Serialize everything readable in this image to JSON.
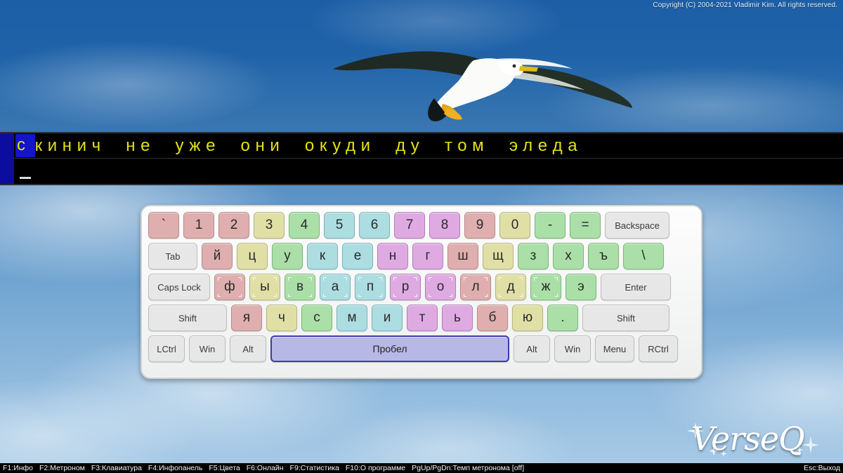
{
  "app": {
    "name": "VerseQ",
    "copyright": "Copyright (C) 2004-2021 Vladimir Kim. All rights reserved.",
    "logo_text": "VerseQ"
  },
  "wallpaper": {
    "description": "seagull-flying-blue-sky",
    "sky_color": "#3d79b5",
    "band_color": "#1f62a8"
  },
  "typing": {
    "cursor_char": "с",
    "line1_rest": "кинич  не  уже  они  окуди  ду  том  элeда",
    "line1_full": "скинич не уже они окуди ду том элeда",
    "line2": "",
    "text_color": "#e3e312",
    "background_color": "#000000",
    "cursor_color": "#1414c8",
    "margin_color": "#0c0c9e"
  },
  "keyboard": {
    "rows": [
      [
        {
          "label": "`",
          "color": "red",
          "type": "char",
          "w": "w-key"
        },
        {
          "label": "1",
          "color": "red",
          "type": "char",
          "w": "w-key"
        },
        {
          "label": "2",
          "color": "red",
          "type": "char",
          "w": "w-key"
        },
        {
          "label": "3",
          "color": "yellow",
          "type": "char",
          "w": "w-key"
        },
        {
          "label": "4",
          "color": "green",
          "type": "char",
          "w": "w-key"
        },
        {
          "label": "5",
          "color": "cyan",
          "type": "char",
          "w": "w-key"
        },
        {
          "label": "6",
          "color": "cyan",
          "type": "char",
          "w": "w-key"
        },
        {
          "label": "7",
          "color": "purple",
          "type": "char",
          "w": "w-key"
        },
        {
          "label": "8",
          "color": "purple",
          "type": "char",
          "w": "w-key"
        },
        {
          "label": "9",
          "color": "red",
          "type": "char",
          "w": "w-key"
        },
        {
          "label": "0",
          "color": "yellow",
          "type": "char",
          "w": "w-key"
        },
        {
          "label": "-",
          "color": "green",
          "type": "char",
          "w": "w-key"
        },
        {
          "label": "=",
          "color": "green",
          "type": "char",
          "w": "w-key"
        },
        {
          "label": "Backspace",
          "color": "mod",
          "type": "mod",
          "w": "w-bksp"
        }
      ],
      [
        {
          "label": "Tab",
          "color": "mod",
          "type": "mod",
          "w": "w-tab"
        },
        {
          "label": "й",
          "color": "red",
          "type": "char",
          "w": "w-key"
        },
        {
          "label": "ц",
          "color": "yellow",
          "type": "char",
          "w": "w-key"
        },
        {
          "label": "у",
          "color": "green",
          "type": "char",
          "w": "w-key"
        },
        {
          "label": "к",
          "color": "cyan",
          "type": "char",
          "w": "w-key"
        },
        {
          "label": "е",
          "color": "cyan",
          "type": "char",
          "w": "w-key"
        },
        {
          "label": "н",
          "color": "purple",
          "type": "char",
          "w": "w-key"
        },
        {
          "label": "г",
          "color": "purple",
          "type": "char",
          "w": "w-key"
        },
        {
          "label": "ш",
          "color": "red",
          "type": "char",
          "w": "w-key"
        },
        {
          "label": "щ",
          "color": "yellow",
          "type": "char",
          "w": "w-key"
        },
        {
          "label": "з",
          "color": "green",
          "type": "char",
          "w": "w-key"
        },
        {
          "label": "х",
          "color": "green",
          "type": "char",
          "w": "w-key"
        },
        {
          "label": "ъ",
          "color": "green",
          "type": "char",
          "w": "w-key"
        },
        {
          "label": "\\",
          "color": "green",
          "type": "char",
          "w": "w-bsl"
        }
      ],
      [
        {
          "label": "Caps Lock",
          "color": "mod",
          "type": "mod",
          "w": "w-caps"
        },
        {
          "label": "ф",
          "color": "red",
          "type": "char",
          "w": "w-key",
          "home": true
        },
        {
          "label": "ы",
          "color": "yellow",
          "type": "char",
          "w": "w-key",
          "home": true
        },
        {
          "label": "в",
          "color": "green",
          "type": "char",
          "w": "w-key",
          "home": true
        },
        {
          "label": "а",
          "color": "cyan",
          "type": "char",
          "w": "w-key",
          "home": true
        },
        {
          "label": "п",
          "color": "cyan",
          "type": "char",
          "w": "w-key",
          "home": true
        },
        {
          "label": "р",
          "color": "purple",
          "type": "char",
          "w": "w-key",
          "home": true
        },
        {
          "label": "о",
          "color": "purple",
          "type": "char",
          "w": "w-key",
          "home": true
        },
        {
          "label": "л",
          "color": "red",
          "type": "char",
          "w": "w-key",
          "home": true
        },
        {
          "label": "д",
          "color": "yellow",
          "type": "char",
          "w": "w-key",
          "home": true
        },
        {
          "label": "ж",
          "color": "green",
          "type": "char",
          "w": "w-key",
          "home": true
        },
        {
          "label": "э",
          "color": "green",
          "type": "char",
          "w": "w-key"
        },
        {
          "label": "Enter",
          "color": "mod",
          "type": "mod",
          "w": "w-enter"
        }
      ],
      [
        {
          "label": "Shift",
          "color": "mod",
          "type": "mod",
          "w": "w-shift"
        },
        {
          "label": "я",
          "color": "red",
          "type": "char",
          "w": "w-key"
        },
        {
          "label": "ч",
          "color": "yellow",
          "type": "char",
          "w": "w-key"
        },
        {
          "label": "с",
          "color": "green",
          "type": "char",
          "w": "w-key"
        },
        {
          "label": "м",
          "color": "cyan",
          "type": "char",
          "w": "w-key"
        },
        {
          "label": "и",
          "color": "cyan",
          "type": "char",
          "w": "w-key"
        },
        {
          "label": "т",
          "color": "purple",
          "type": "char",
          "w": "w-key"
        },
        {
          "label": "ь",
          "color": "purple",
          "type": "char",
          "w": "w-key"
        },
        {
          "label": "б",
          "color": "red",
          "type": "char",
          "w": "w-key"
        },
        {
          "label": "ю",
          "color": "yellow",
          "type": "char",
          "w": "w-key"
        },
        {
          "label": ".",
          "color": "green",
          "type": "char",
          "w": "w-key"
        },
        {
          "label": "Shift",
          "color": "mod",
          "type": "mod",
          "w": "w-rshift"
        }
      ],
      [
        {
          "label": "LCtrl",
          "color": "mod",
          "type": "mod",
          "w": "w-mod"
        },
        {
          "label": "Win",
          "color": "mod",
          "type": "mod",
          "w": "w-mod"
        },
        {
          "label": "Alt",
          "color": "mod",
          "type": "mod",
          "w": "w-mod"
        },
        {
          "label": "Пробел",
          "color": "space",
          "type": "space",
          "w": "w-space",
          "highlighted": true
        },
        {
          "label": "Alt",
          "color": "mod",
          "type": "mod",
          "w": "w-mod"
        },
        {
          "label": "Win",
          "color": "mod",
          "type": "mod",
          "w": "w-mod"
        },
        {
          "label": "Menu",
          "color": "mod",
          "type": "mod",
          "w": "w-menu"
        },
        {
          "label": "RCtrl",
          "color": "mod",
          "type": "mod",
          "w": "w-menu"
        }
      ]
    ],
    "colors": {
      "red": "#dfaeae",
      "yellow": "#e0e0a6",
      "green": "#aadfa8",
      "cyan": "#abdde1",
      "purple": "#dfaae2",
      "space": "#b7b8e6",
      "modifier": "#e7e7e7"
    }
  },
  "statusbar": {
    "hints": [
      "F1:Инфо",
      "F2:Метроном",
      "F3:Клавиатура",
      "F4:Инфопанель",
      "F5:Цвета",
      "F6:Онлайн",
      "F9:Статистика",
      "F10:О программе",
      "PgUp/PgDn:Темп метронома [off]"
    ],
    "exit": "Esc:Выход"
  }
}
